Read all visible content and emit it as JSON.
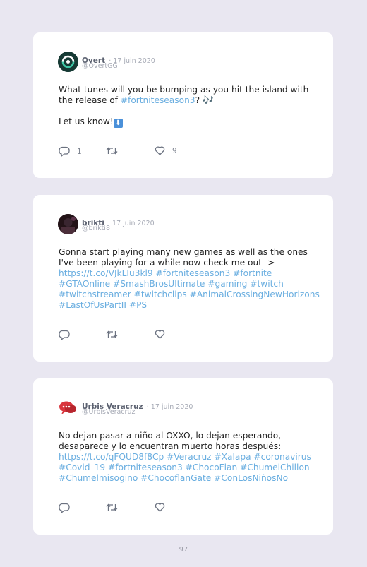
{
  "tweets": [
    {
      "name": "Overt",
      "date": "· 17 juin 2020",
      "handle": "@OvertGG",
      "line1": "What tunes will you be bumping as you hit the island with",
      "line2_pre": "the release of ",
      "line2_link": "#fortniteseason3",
      "line2_post": "? ",
      "line2_emoji": "🎶",
      "line3": "Let us know!",
      "line3_emoji": "⬇",
      "reply_count": "1",
      "like_count": "9"
    },
    {
      "name": "brikti",
      "date": "· 17 juin 2020",
      "handle": "@brikti8",
      "lines": [
        "Gonna start playing many new games as well as the ones",
        "I've been playing for a while now check me out ->"
      ],
      "links": [
        "https://t.co/VJkLIu3kl9 #fortniteseason3 #fortnite",
        "#GTAOnline #SmashBrosUltimate #gaming #twitch",
        "#twitchstreamer #twitchclips #AnimalCrossingNewHorizons",
        "#LastOfUsPartII #PS"
      ]
    },
    {
      "name": "Urbis Veracruz",
      "date": "· 17 juin 2020",
      "handle": "@UrbisVeracruz",
      "lines": [
        "No dejan pasar a niño al OXXO, lo dejan esperando,",
        "desaparece y lo encuentran muerto horas después:"
      ],
      "links": [
        "https://t.co/qFQUD8f8Cp #Veracruz #Xalapa #coronavirus",
        "#Covid_19 #fortniteseason3 #ChocoFlan #ChumelChillon",
        "#Chumelmisogino #ChocoflanGate #ConLosNiñosNo"
      ]
    }
  ],
  "page_number": "97",
  "colors": {
    "background": "#e9e7f1",
    "card": "#ffffff",
    "link": "#6aaee0",
    "icon": "#6b7280"
  },
  "icons": [
    "reply-icon",
    "retweet-icon",
    "like-icon"
  ]
}
